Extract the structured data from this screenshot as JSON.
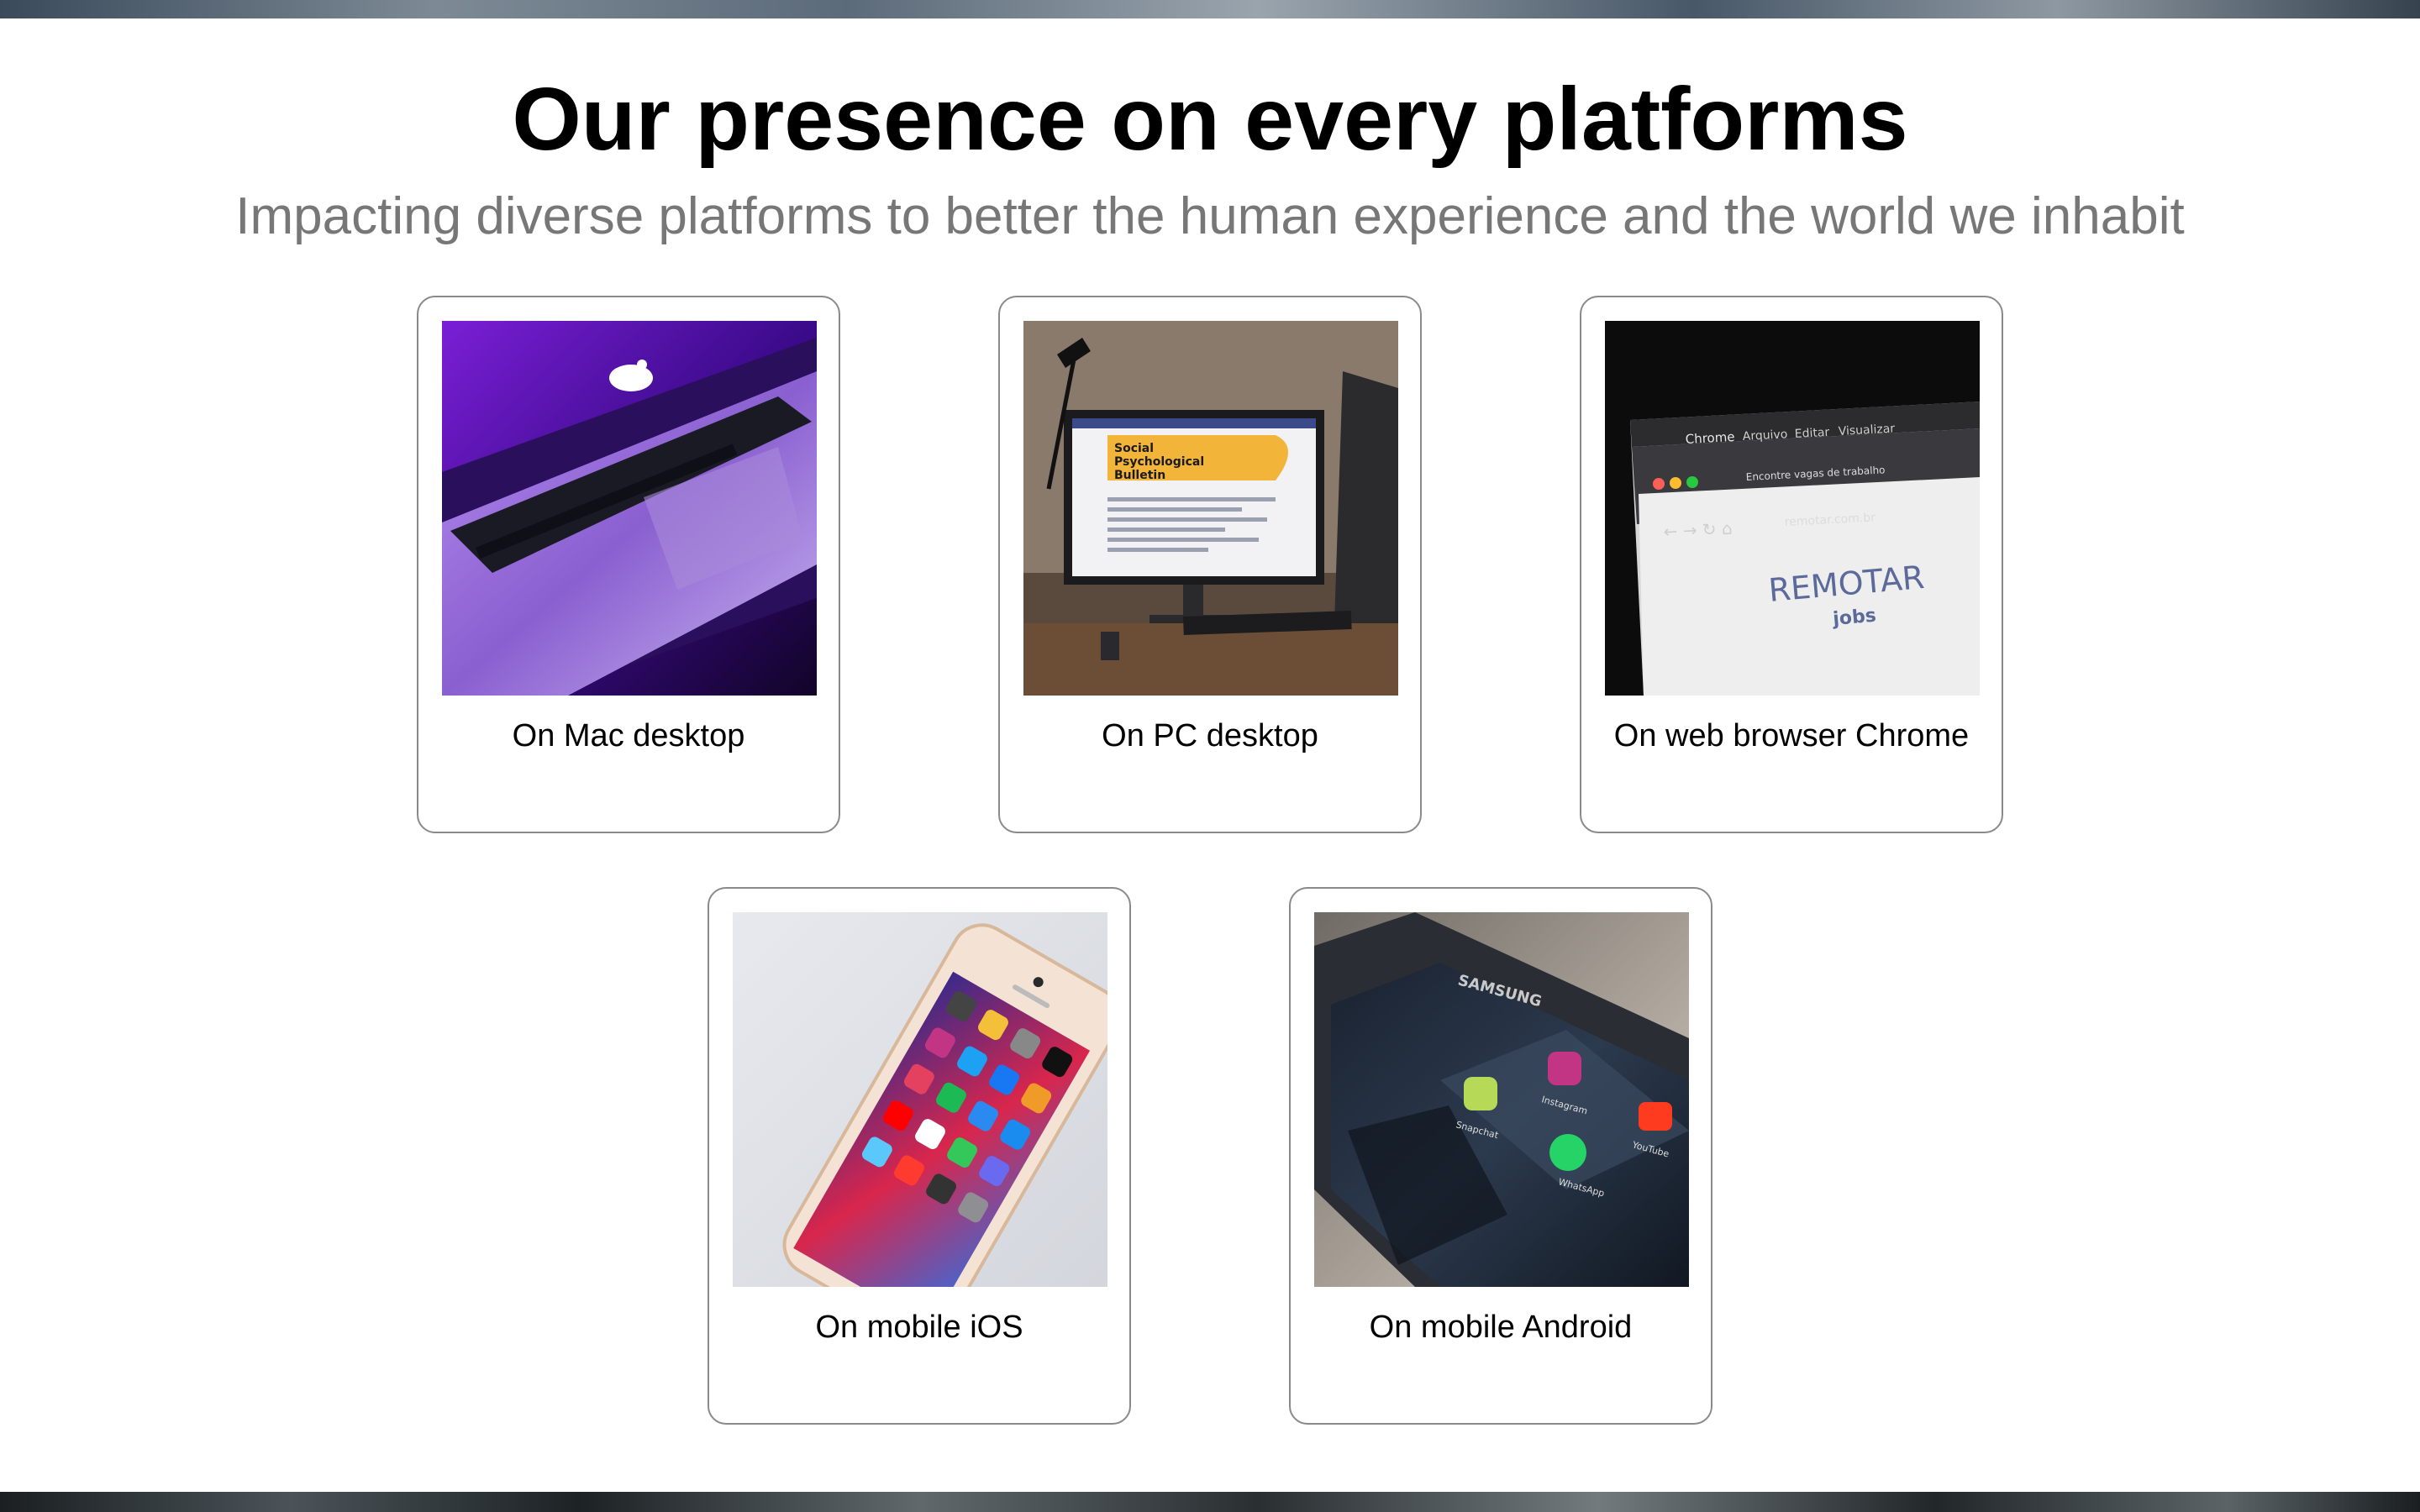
{
  "header": {
    "title": "Our presence on every platforms",
    "subtitle": "Impacting diverse platforms to better the human experience and the world we inhabit"
  },
  "platforms": [
    {
      "label": "On Mac desktop",
      "image": "laptop-photo"
    },
    {
      "label": "On PC desktop",
      "image": "pc-monitor-photo"
    },
    {
      "label": "On web browser Chrome",
      "image": "browser-photo"
    },
    {
      "label": "On mobile iOS",
      "image": "iphone-photo"
    },
    {
      "label": "On mobile Android",
      "image": "android-phone-photo"
    }
  ],
  "photo_text": {
    "chrome_menu": "Chrome",
    "chrome_menu_2": "Arquivo",
    "chrome_menu_3": "Editar",
    "chrome_menu_4": "Visualizar",
    "chrome_tab": "Encontre vagas de trabalho",
    "chrome_url": "remotar.com.br",
    "remotar_logo": "REMOTAR",
    "remotar_sub": "jobs",
    "pc_heading_1": "Social",
    "pc_heading_2": "Psychological",
    "pc_heading_3": "Bulletin",
    "android_brand": "SAMSUNG",
    "android_app_1": "Snapchat",
    "android_app_2": "Instagram",
    "android_app_3": "WhatsApp",
    "android_app_4": "YouTube"
  }
}
